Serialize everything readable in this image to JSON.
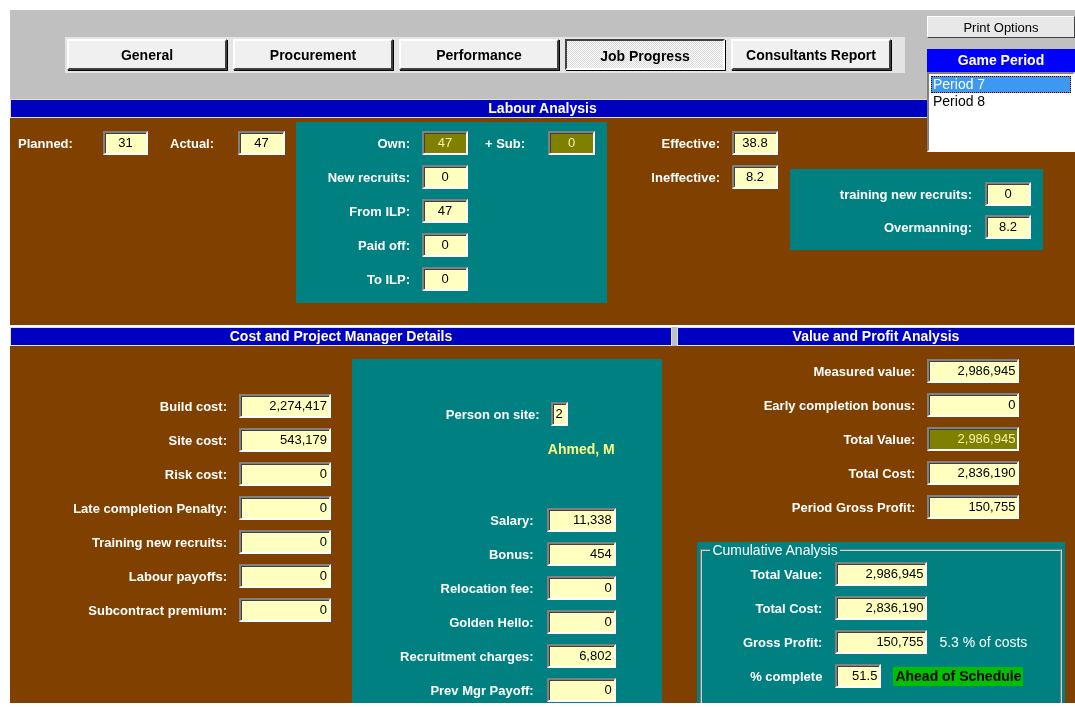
{
  "tabs": [
    {
      "label": "General",
      "selected": false
    },
    {
      "label": "Procurement",
      "selected": false
    },
    {
      "label": "Performance",
      "selected": false
    },
    {
      "label": "Job Progress",
      "selected": true
    },
    {
      "label": "Consultants Report",
      "selected": false
    }
  ],
  "print_button": {
    "label": "Print Options"
  },
  "game_period": {
    "title": "Game Period",
    "items": [
      {
        "label": "Period 7",
        "selected": true
      },
      {
        "label": "Period 8",
        "selected": false
      }
    ]
  },
  "labour_analysis": {
    "title": "Labour Analysis",
    "headcount": [
      {
        "label": "Planned:",
        "value": "31",
        "highlighted": false
      },
      {
        "label": "Actual:",
        "value": "47",
        "highlighted": false
      }
    ],
    "workforce": {
      "own": {
        "label": "Own:",
        "value": "47",
        "highlighted": true
      },
      "sub": {
        "label": "+ Sub:",
        "value": "0",
        "highlighted": true
      },
      "fields": [
        {
          "label": "New recruits:",
          "value": "0",
          "highlighted": false
        },
        {
          "label": "From ILP:",
          "value": "47",
          "highlighted": false
        },
        {
          "label": "Paid off:",
          "value": "0",
          "highlighted": false
        },
        {
          "label": "To ILP:",
          "value": "0",
          "highlighted": false
        }
      ]
    },
    "effectiveness": [
      {
        "label": "Effective:",
        "value": "38.8",
        "highlighted": false
      },
      {
        "label": "Ineffective:",
        "value": "8.2",
        "highlighted": false
      }
    ],
    "overmanning": [
      {
        "label": "training new recruits:",
        "value": "0",
        "highlighted": false
      },
      {
        "label": "Overmanning:",
        "value": "8.2",
        "highlighted": false
      }
    ]
  },
  "cost_details": {
    "title": "Cost and Project Manager Details",
    "fields": [
      {
        "label": "Build cost:",
        "value": "2,274,417",
        "highlighted": false
      },
      {
        "label": "Site cost:",
        "value": "543,179",
        "highlighted": false
      },
      {
        "label": "Risk cost:",
        "value": "0",
        "highlighted": false
      },
      {
        "label": "Late completion Penalty:",
        "value": "0",
        "highlighted": false
      },
      {
        "label": "Training new recruits:",
        "value": "0",
        "highlighted": false
      },
      {
        "label": "Labour payoffs:",
        "value": "0",
        "highlighted": false
      },
      {
        "label": "Subcontract premium:",
        "value": "0",
        "highlighted": false
      }
    ],
    "manager": {
      "person": {
        "label": "Person on site:",
        "value": "2",
        "highlighted": false
      },
      "name": "Ahmed, M",
      "fields": [
        {
          "label": "Salary:",
          "value": "11,338",
          "highlighted": false
        },
        {
          "label": "Bonus:",
          "value": "454",
          "highlighted": false
        },
        {
          "label": "Relocation fee:",
          "value": "0",
          "highlighted": false
        },
        {
          "label": "Golden Hello:",
          "value": "0",
          "highlighted": false
        },
        {
          "label": "Recruitment charges:",
          "value": "6,802",
          "highlighted": false
        },
        {
          "label": "Prev Mgr Payoff:",
          "value": "0",
          "highlighted": false
        }
      ]
    }
  },
  "value_profit": {
    "title": "Value and Profit Analysis",
    "fields": [
      {
        "label": "Measured value:",
        "value": "2,986,945",
        "highlighted": false
      },
      {
        "label": "Early completion bonus:",
        "value": "0",
        "highlighted": false
      },
      {
        "label": "Total Value:",
        "value": "2,986,945",
        "highlighted": true
      },
      {
        "label": "Total Cost:",
        "value": "2,836,190",
        "highlighted": false
      },
      {
        "label": "Period Gross Profit:",
        "value": "150,755",
        "highlighted": false
      }
    ],
    "cumulative": {
      "title": "Cumulative Analysis",
      "fields": [
        {
          "label": "Total Value:",
          "value": "2,986,945",
          "highlighted": false
        },
        {
          "label": "Total Cost:",
          "value": "2,836,190",
          "highlighted": false
        },
        {
          "label": "Gross Profit:",
          "value": "150,755",
          "highlighted": false,
          "note": "5.3 % of costs"
        }
      ],
      "percent": {
        "label": "% complete",
        "value": "51.5",
        "highlighted": false
      },
      "status": "Ahead of Schedule"
    }
  }
}
